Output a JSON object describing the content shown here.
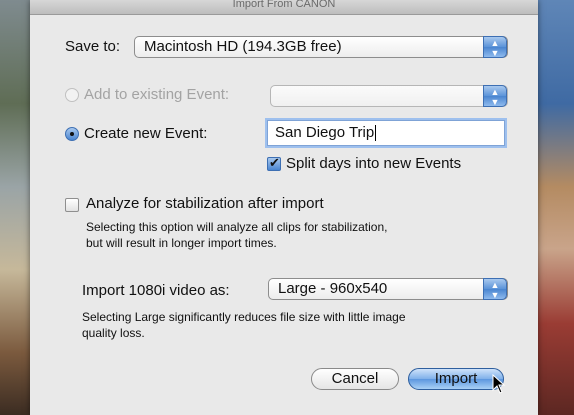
{
  "dialog": {
    "title": "Import From CANON"
  },
  "save_to": {
    "label": "Save to:",
    "value": "Macintosh HD (194.3GB free)"
  },
  "event": {
    "add_existing_label": "Add to existing Event:",
    "add_existing_value": "",
    "create_new_label": "Create new Event:",
    "create_new_value": "San Diego Trip",
    "split_days_label": "Split days into new Events"
  },
  "stabilization": {
    "label": "Analyze for stabilization after import",
    "note_line1": "Selecting this option will analyze all clips for stabilization,",
    "note_line2": "but will result in longer import times."
  },
  "import_size": {
    "label": "Import 1080i video as:",
    "value": "Large - 960x540",
    "note_line1": "Selecting Large significantly reduces file size with little image",
    "note_line2": "quality loss."
  },
  "buttons": {
    "cancel": "Cancel",
    "import": "Import"
  },
  "icons": {
    "popup_arrows": "updown-chevron-icon",
    "pointer": "mouse-pointer-icon"
  },
  "colors": {
    "accent": "#5a93d9",
    "sheet_bg": "#e9e9e9"
  }
}
